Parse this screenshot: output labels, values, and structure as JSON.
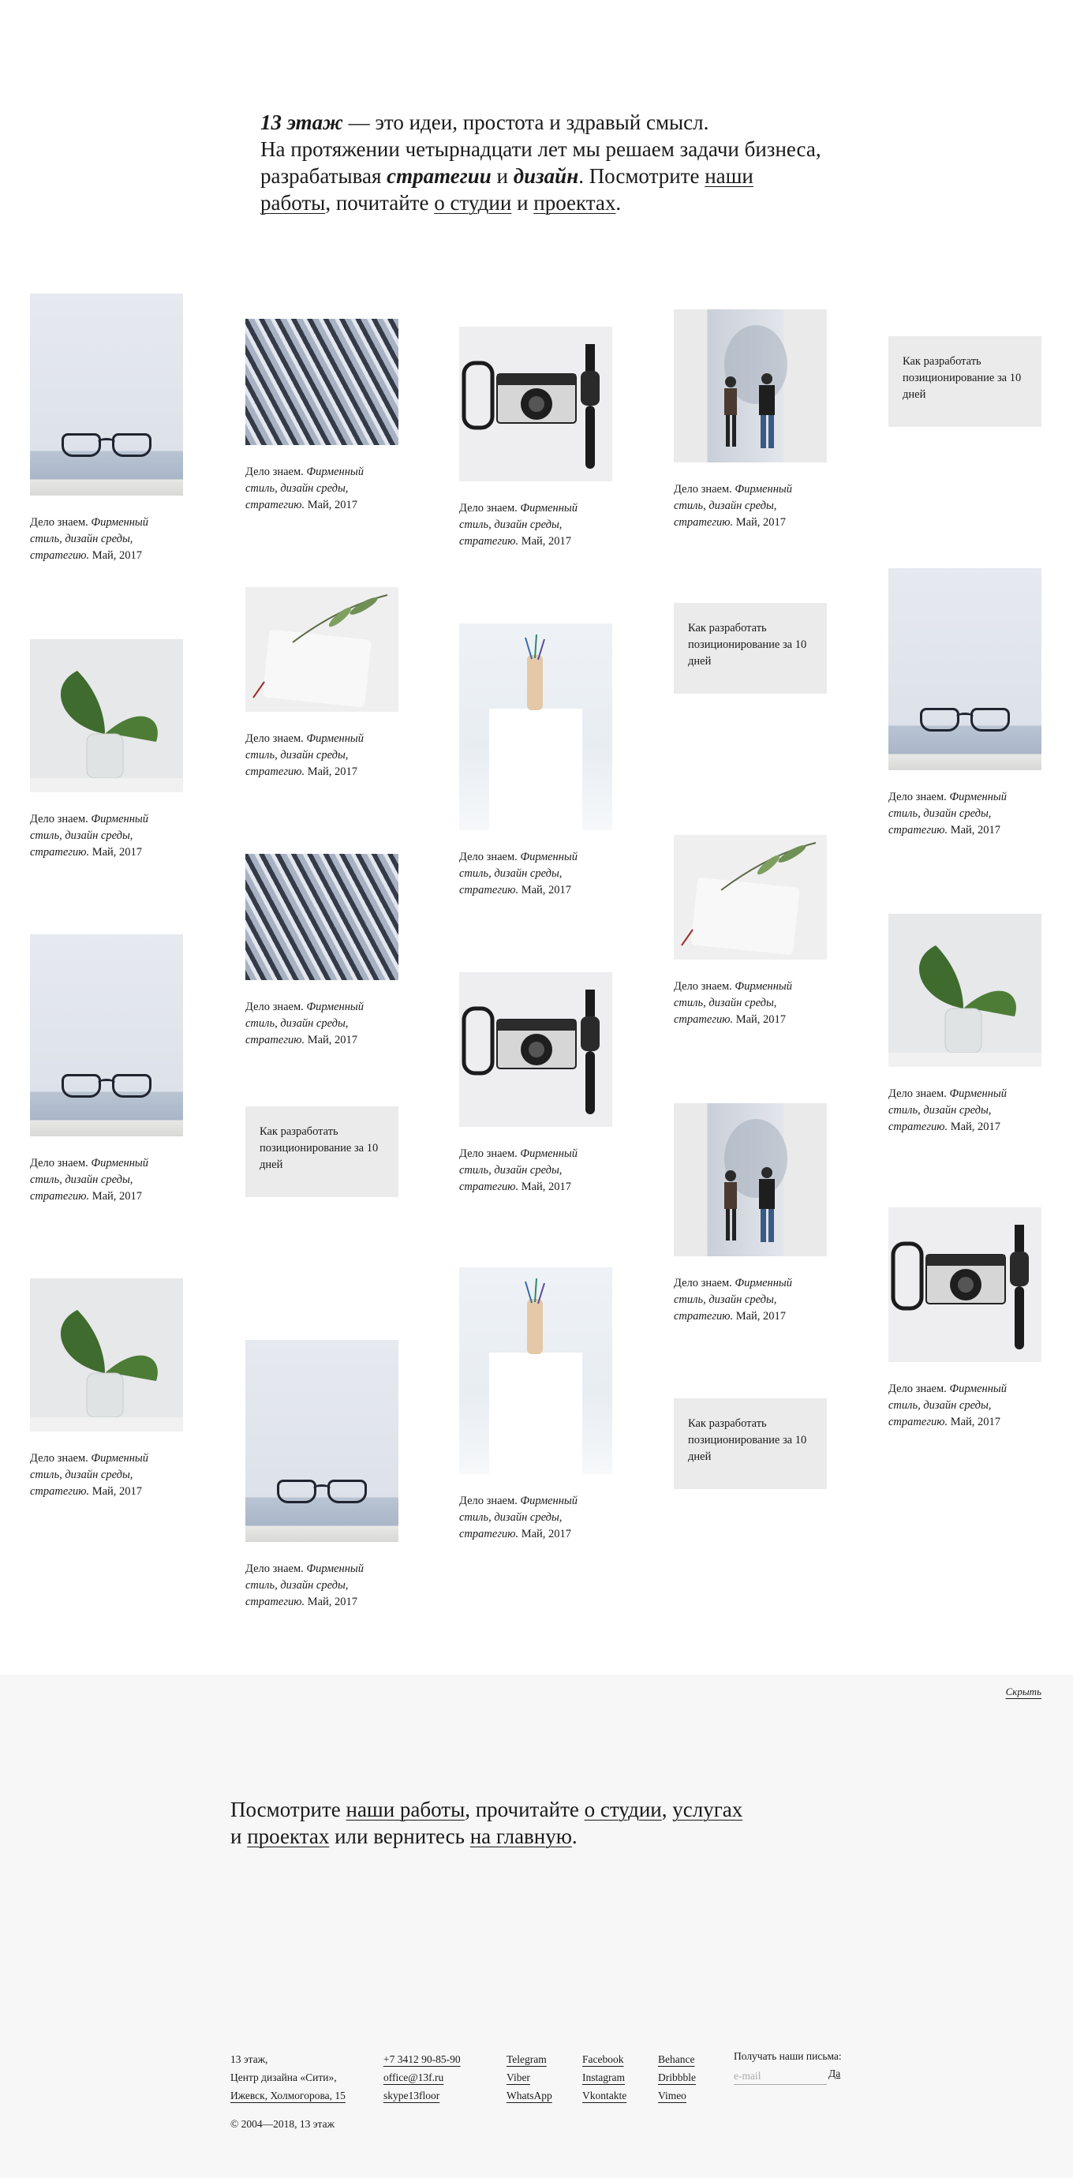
{
  "intro": {
    "brand": "13 этаж",
    "t1": " — это идеи, простота и здравый смысл.",
    "t2": "На протяжении четырнадцати лет мы решаем задачи бизнеса, разрабатывая ",
    "strategy": "стратегии",
    "t3": " и ",
    "design": "дизайн",
    "t4": ". Посмотрите ",
    "link_works": "наши работы",
    "t5": ", почитайте ",
    "link_studio": "о студии",
    "t6": " и ",
    "link_projects": "проектах",
    "t7": "."
  },
  "card": {
    "cap_a": "Дело знаем. ",
    "cap_b": "Фирменный стиль, дизайн среды, стратегию.",
    "cap_c": " Май, 2017"
  },
  "promo": {
    "text": "Как разработать позиционирование за 10 дней"
  },
  "footer": {
    "hide": "Скрыть",
    "f1": "Посмотрите ",
    "link_works": "наши работы",
    "f2": ", прочитайте ",
    "link_studio": "о студии",
    "f3": ", ",
    "link_services": "услугах",
    "f4": " и ",
    "link_projects": "проектах",
    "f5": " или вернитесь ",
    "link_home": "на главную",
    "f6": ".",
    "address": [
      "13 этаж,",
      "Центр дизайна «Сити»,",
      "Ижевск, Холмогорова, 15"
    ],
    "contacts": [
      "+7 3412 90-85-90",
      "office@13f.ru",
      "skype13floor"
    ],
    "messengers": [
      "Telegram",
      "Viber",
      "WhatsApp"
    ],
    "social1": [
      "Facebook",
      "Instagram",
      "Vkontakte"
    ],
    "social2": [
      "Behance",
      "Dribbble",
      "Vimeo"
    ],
    "subscribe_label": "Получать наши письма:",
    "email_placeholder": "e-mail",
    "subscribe_button": "Да",
    "copyright": "© 2004—2018, 13 этаж"
  }
}
